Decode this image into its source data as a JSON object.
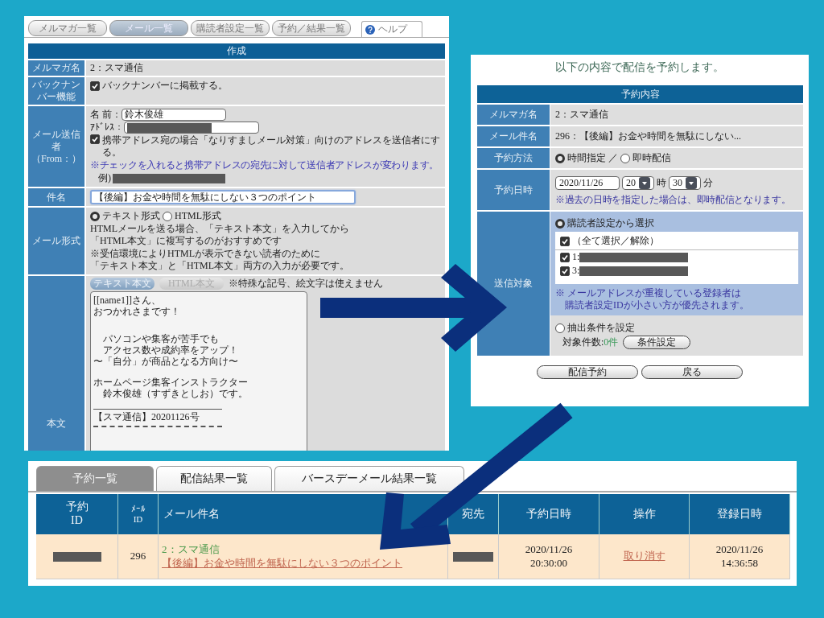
{
  "compose_screen": {
    "nav_tabs": [
      {
        "label": "メルマガ一覧",
        "selected": false
      },
      {
        "label": "メール一覧",
        "selected": true
      },
      {
        "label": "購読者設定一覧",
        "selected": false
      },
      {
        "label": "予約／結果一覧",
        "selected": false
      }
    ],
    "help_tab": "ヘルプ",
    "form_title": "作成",
    "magazine": {
      "label": "メルマガ名",
      "value": "2：スマ通信"
    },
    "back_number": {
      "label": "バックナンバー機能",
      "text": "バックナンバーに掲載する。",
      "checked": true
    },
    "sender": {
      "label": "メール送信者",
      "sublabel": "（From：）",
      "name_label": "名 前：",
      "name_value": "鈴木俊雄",
      "address_label": "ｱﾄﾞﾚｽ：",
      "spoof_text": "携帯アドレス宛の場合「なりすましメール対策」向けのアドレスを送信者にする。",
      "spoof_checked": true,
      "note": "※チェックを入れると携帯アドレスの宛先に対して送信者アドレスが変わります。",
      "example_label": "例)"
    },
    "subject": {
      "label": "件名",
      "value": "【後編】お金や時間を無駄にしない３つのポイント"
    },
    "format": {
      "label": "メール形式",
      "options": [
        {
          "label": "テキスト形式",
          "selected": true
        },
        {
          "label": "HTML形式",
          "selected": false
        }
      ],
      "help": [
        "HTMLメールを送る場合、「テキスト本文」を入力してから",
        "「HTML本文」に複写するのがおすすめです"
      ],
      "note": [
        "※受信環境によりHTMLが表示できない読者のために",
        "「テキスト本文」と「HTML本文」両方の入力が必要です。"
      ]
    },
    "body": {
      "label": "本文",
      "tabs": [
        {
          "label": "テキスト本文",
          "selected": true
        },
        {
          "label": "HTML本文",
          "selected": false
        }
      ],
      "note": "※特殊な記号、絵文字は使えません",
      "paragraphs": [
        [
          "[[name1]]さん、",
          "おつかれさまです！"
        ],
        [
          "　パソコンや集客が苦手でも",
          "　アクセス数や成約率をアップ！",
          "〜「自分」が商品となる方向け〜"
        ],
        [
          "ホームページ集客インストラクター",
          "　鈴木俊雄（すずきとしお）です。"
        ]
      ],
      "signature": "【スマ通信】20201126号"
    }
  },
  "confirm_screen": {
    "heading": "以下の内容で配信を予約します。",
    "table_title": "予約内容",
    "magazine": {
      "label": "メルマガ名",
      "value": "2：スマ通信"
    },
    "subject": {
      "label": "メール件名",
      "value": "296：【後編】お金や時間を無駄にしない..."
    },
    "method": {
      "label": "予約方法",
      "options": [
        {
          "label": "時間指定",
          "selected": true
        },
        {
          "label": "即時配信",
          "selected": false
        }
      ],
      "separator": "／"
    },
    "datetime": {
      "label": "予約日時",
      "date": "2020/11/26",
      "hour": "20",
      "hour_unit": "時",
      "minute": "30",
      "minute_unit": "分",
      "note": "※過去の日時を指定した場合は、即時配信となります。"
    },
    "target": {
      "label": "送信対象",
      "modes": [
        {
          "label": "購読者設定から選択",
          "selected": true
        },
        {
          "label": "抽出条件を設定",
          "selected": false
        }
      ],
      "select_all": {
        "label": "（全て選択／解除）",
        "checked": true
      },
      "subscribers": [
        {
          "label": "1:",
          "checked": true
        },
        {
          "label": "3:",
          "checked": true
        }
      ],
      "note": [
        "※ メールアドレスが重複している登録者は",
        "購読者設定IDが小さい方が優先されます。"
      ],
      "count_label": "対象件数:",
      "count": "0件",
      "condition_button": "条件設定"
    },
    "buttons": [
      "配信予約",
      "戻る"
    ]
  },
  "reservation_screen": {
    "tabs": [
      {
        "label": "予約一覧",
        "selected": true
      },
      {
        "label": "配信結果一覧",
        "selected": false
      },
      {
        "label": "バースデーメール結果一覧",
        "selected": false
      }
    ],
    "columns": [
      "予約\nID",
      "ﾒｰﾙ\nID",
      "メール件名",
      "宛先",
      "予約日時",
      "操作",
      "登録日時"
    ],
    "rows": [
      {
        "mail_id": "296",
        "magazine": "2：スマ通信",
        "subject": "【後編】お金や時間を無駄にしない３つのポイント",
        "scheduled": "2020/11/26\n20:30:00",
        "action": "取り消す",
        "registered": "2020/11/26\n14:36:58"
      }
    ]
  }
}
